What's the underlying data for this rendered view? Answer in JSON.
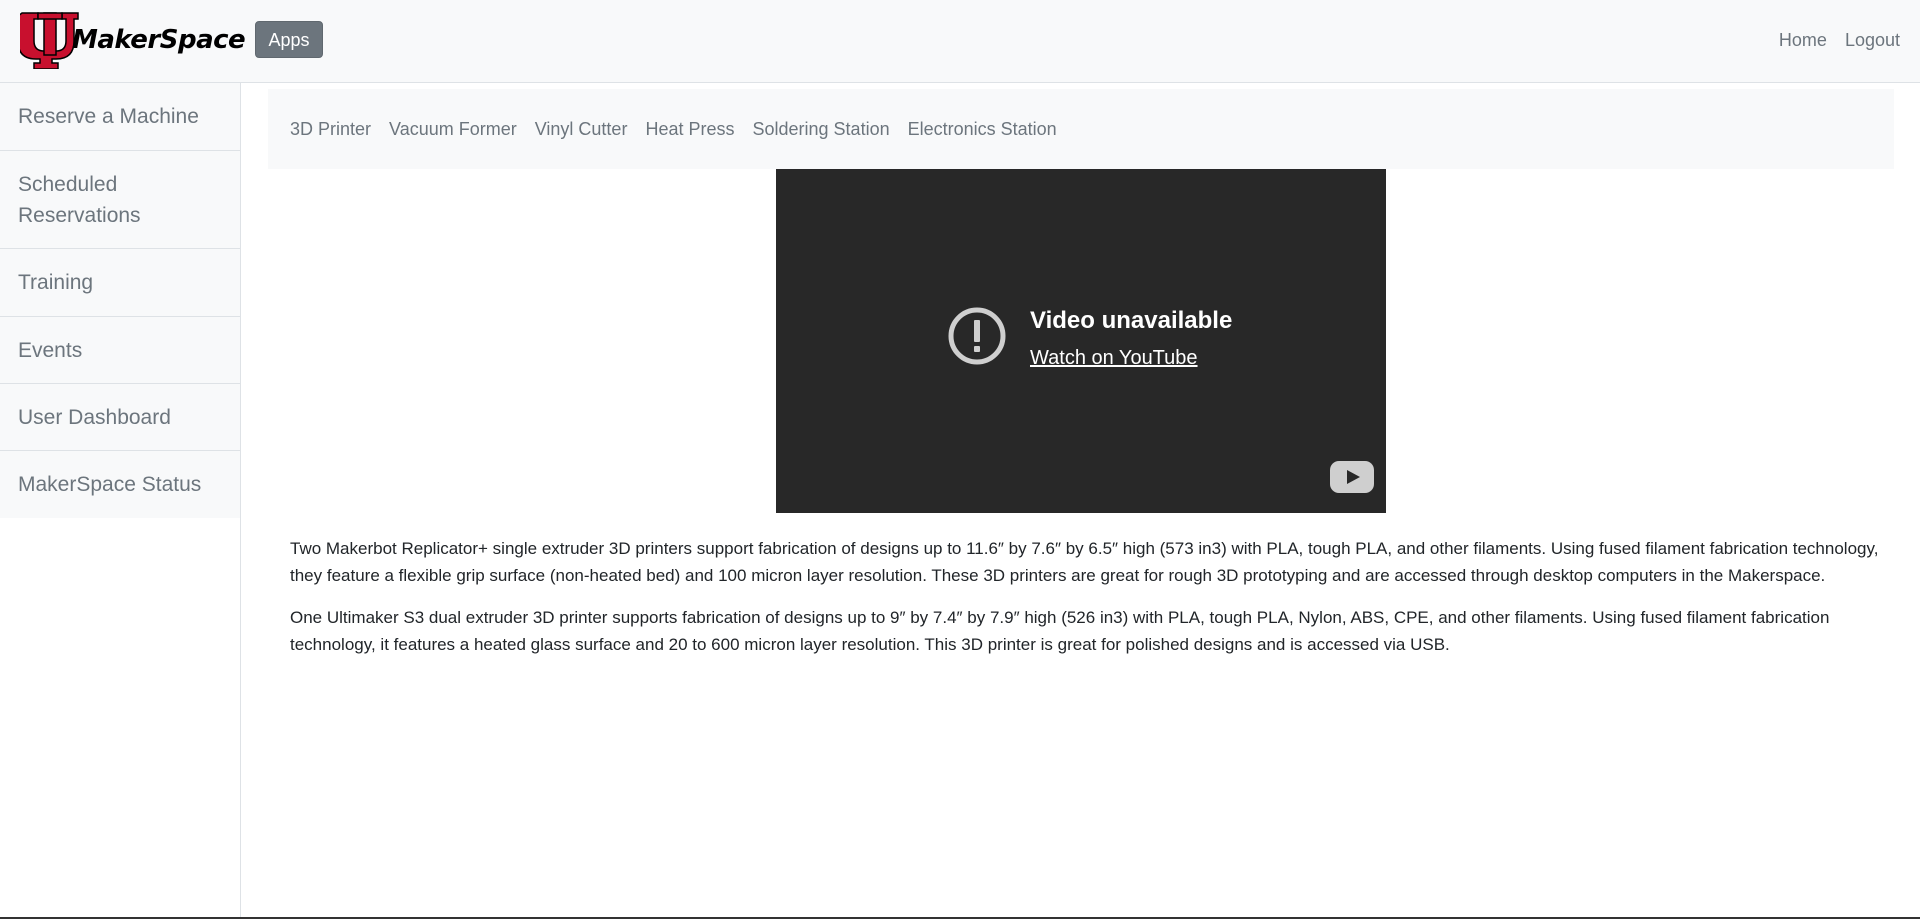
{
  "brand": {
    "logo_text": "MakerSpace"
  },
  "header": {
    "apps_label": "Apps",
    "nav": [
      {
        "label": "Home"
      },
      {
        "label": "Logout"
      }
    ]
  },
  "sidebar": {
    "items": [
      {
        "label": "Reserve a Machine"
      },
      {
        "label": "Scheduled Reservations"
      },
      {
        "label": "Training"
      },
      {
        "label": "Events"
      },
      {
        "label": "User Dashboard"
      },
      {
        "label": "MakerSpace Status"
      }
    ]
  },
  "machines_nav": {
    "items": [
      {
        "label": "3D Printer"
      },
      {
        "label": "Vacuum Former"
      },
      {
        "label": "Vinyl Cutter"
      },
      {
        "label": "Heat Press"
      },
      {
        "label": "Soldering Station"
      },
      {
        "label": "Electronics Station"
      }
    ]
  },
  "video": {
    "title": "Video unavailable",
    "link": "Watch on YouTube",
    "warning_icon": "exclamation-circle-icon",
    "play_icon": "youtube-icon"
  },
  "content": {
    "paragraphs": [
      "Two Makerbot Replicator+ single extruder 3D printers support fabrication of designs up to 11.6″ by 7.6″ by 6.5″ high (573 in3) with PLA, tough PLA, and other filaments. Using fused filament fabrication technology, they feature a flexible grip surface (non-heated bed) and 100 micron layer resolution. These 3D printers are great for rough 3D prototyping and are accessed through desktop computers in the Makerspace.",
      "One Ultimaker S3 dual extruder 3D printer supports fabrication of designs up to 9″ by 7.4″ by 7.9″ high (526 in3) with PLA, tough PLA, Nylon, ABS, CPE, and other filaments. Using fused filament fabrication technology, it features a heated glass surface and 20 to 600 micron layer resolution. This 3D printer is great for polished designs and is accessed via USB."
    ]
  },
  "colors": {
    "logo_red": "#c8102e",
    "muted_text": "#6c757d",
    "apps_button": "#6c757d",
    "video_bg": "#282828"
  }
}
